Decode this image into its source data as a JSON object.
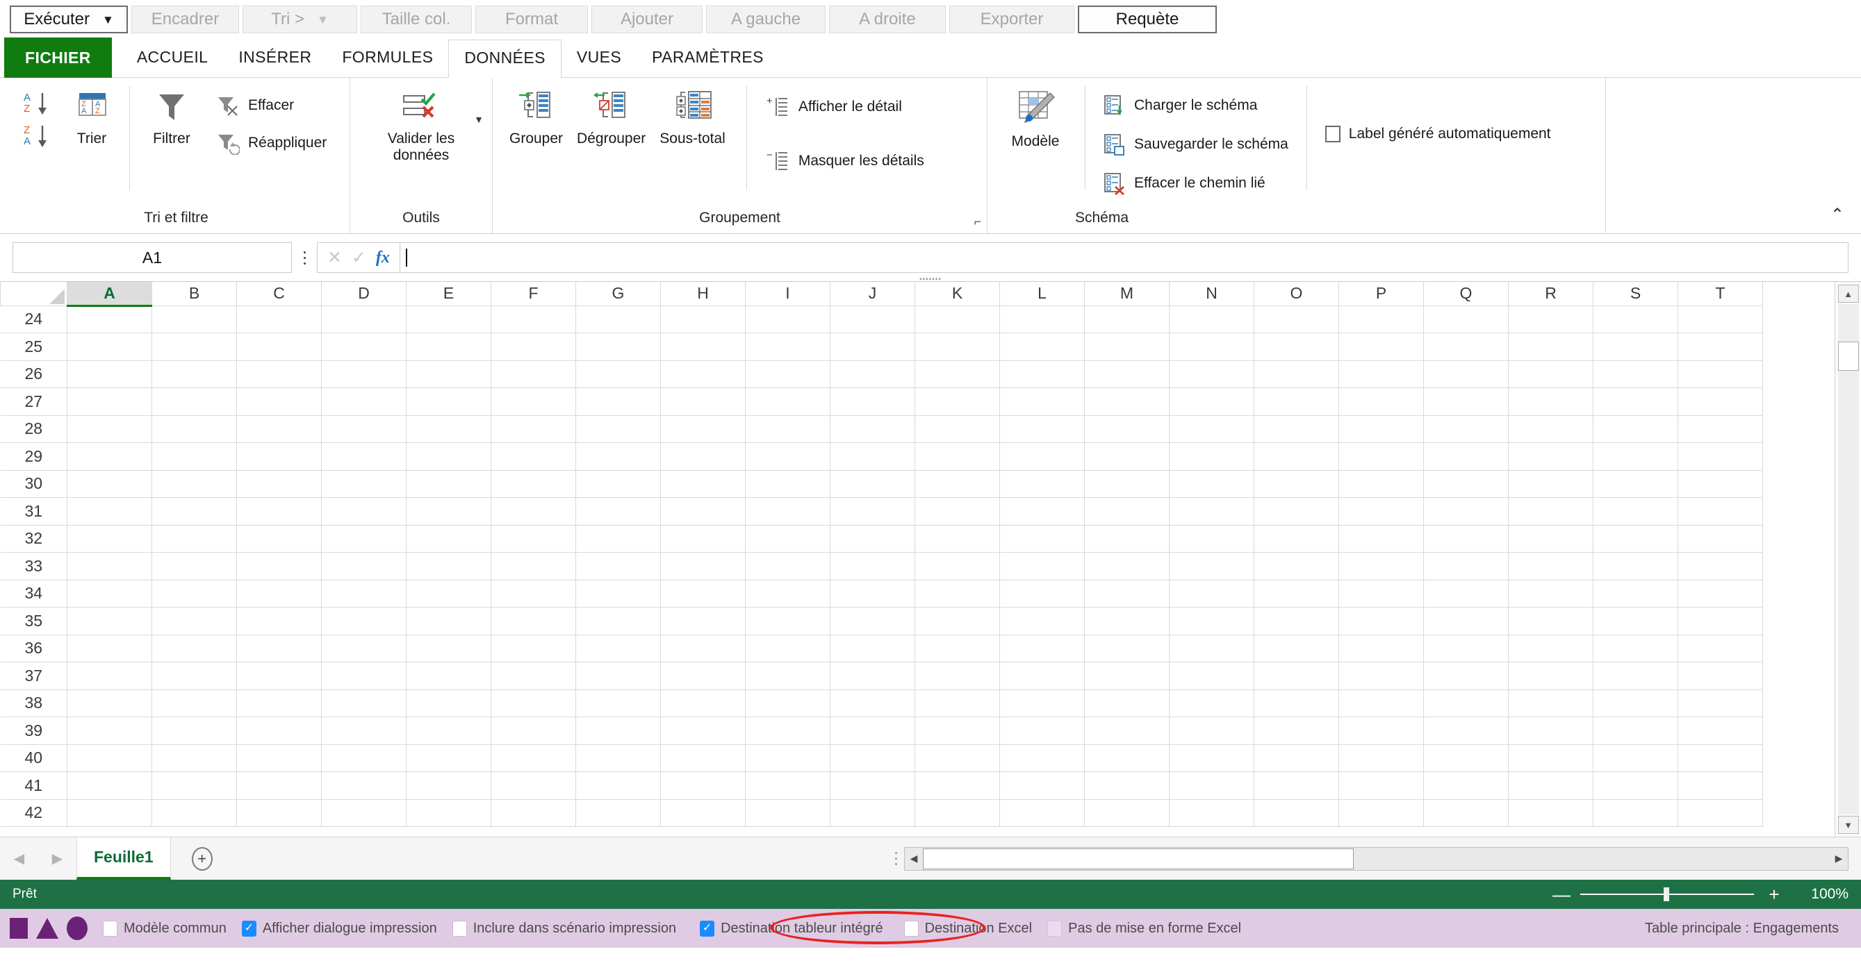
{
  "command_toolbar": {
    "buttons": [
      {
        "label": "Exécuter",
        "state": "active",
        "has_caret": true
      },
      {
        "label": "Encadrer",
        "state": "disabled",
        "has_caret": false
      },
      {
        "label": "Tri >",
        "state": "disabled",
        "has_caret": true
      },
      {
        "label": "Taille col.",
        "state": "disabled",
        "has_caret": false
      },
      {
        "label": "Format",
        "state": "disabled",
        "has_caret": false
      },
      {
        "label": "Ajouter",
        "state": "disabled",
        "has_caret": false
      },
      {
        "label": "A gauche",
        "state": "disabled",
        "has_caret": false
      },
      {
        "label": "A droite",
        "state": "disabled",
        "has_caret": false
      },
      {
        "label": "Exporter",
        "state": "disabled",
        "has_caret": false
      },
      {
        "label": "Requète",
        "state": "active",
        "has_caret": false
      }
    ]
  },
  "ribbon_tabs": [
    {
      "label": "FICHIER",
      "type": "file"
    },
    {
      "label": "ACCUEIL",
      "type": "normal"
    },
    {
      "label": "INSÉRER",
      "type": "normal"
    },
    {
      "label": "FORMULES",
      "type": "normal"
    },
    {
      "label": "DONNÉES",
      "type": "selected"
    },
    {
      "label": "VUES",
      "type": "normal"
    },
    {
      "label": "PARAMÈTRES",
      "type": "normal"
    }
  ],
  "ribbon": {
    "groups": [
      {
        "title": "Tri et filtre",
        "sort_asc_icon": "sort-ascending-icon",
        "sort_desc_icon": "sort-descending-icon",
        "sort_label": "Trier",
        "filter_label": "Filtrer",
        "clear_label": "Effacer",
        "reapply_label": "Réappliquer"
      },
      {
        "title": "Outils",
        "validate_label": "Valider les données"
      },
      {
        "title": "Groupement",
        "group_label": "Grouper",
        "ungroup_label": "Dégrouper",
        "subtotal_label": "Sous-total",
        "show_detail_label": "Afficher le détail",
        "hide_detail_label": "Masquer les détails",
        "has_dialog_launcher": true
      },
      {
        "title": "Schéma",
        "model_label": "Modèle",
        "load_schema_label": "Charger le schéma",
        "save_schema_label": "Sauvegarder le schéma",
        "clear_link_label": "Effacer le chemin lié",
        "auto_label_checkbox": "Label généré automatiquement",
        "auto_label_checked": false
      }
    ]
  },
  "formula_bar": {
    "name_box_value": "A1",
    "cancel_icon": "cancel-icon",
    "accept_icon": "accept-icon",
    "function_icon": "fx-icon",
    "formula_value": ""
  },
  "grid": {
    "columns": [
      "A",
      "B",
      "C",
      "D",
      "E",
      "F",
      "G",
      "H",
      "I",
      "J",
      "K",
      "L",
      "M",
      "N",
      "O",
      "P",
      "Q",
      "R",
      "S",
      "T"
    ],
    "selected_column": "A",
    "rows": [
      24,
      25,
      26,
      27,
      28,
      29,
      30,
      31,
      32,
      33,
      34,
      35,
      36,
      37,
      38,
      39,
      40,
      41,
      42
    ],
    "selected_cell": "A1"
  },
  "sheet_bar": {
    "prev_icon": "chevron-left-icon",
    "next_icon": "chevron-right-icon",
    "tabs": [
      {
        "label": "Feuille1",
        "active": true
      }
    ],
    "add_sheet_icon": "plus-circle-icon"
  },
  "status_bar": {
    "status_text": "Prêt",
    "zoom_out_icon": "minus-icon",
    "zoom_in_icon": "plus-icon",
    "zoom_value": "100%"
  },
  "bottom_bar": {
    "shapes": [
      "square-shape",
      "triangle-shape",
      "ellipse-shape"
    ],
    "checkboxes": [
      {
        "label": "Modèle commun",
        "checked": false,
        "style": "normal"
      },
      {
        "label": "Afficher dialogue impression",
        "checked": true,
        "style": "normal"
      },
      {
        "label": "Inclure dans scénario impression",
        "checked": false,
        "style": "normal"
      },
      {
        "label": "Destination tableur intégré",
        "checked": true,
        "style": "normal"
      },
      {
        "label": "Destination Excel",
        "checked": false,
        "style": "normal"
      },
      {
        "label": "Pas de mise en forme Excel",
        "checked": false,
        "style": "ghost"
      }
    ],
    "right_text": "Table principale : Engagements",
    "annotation": {
      "type": "red-ellipse",
      "target": "Destination tableur intégré"
    }
  },
  "colors": {
    "file_tab_green": "#107c10",
    "status_green": "#1e7145",
    "bottom_purple": "#e0cbe4",
    "shape_purple": "#6b2175",
    "checkbox_blue": "#1a8cff",
    "annotation_red": "#e8231f"
  }
}
